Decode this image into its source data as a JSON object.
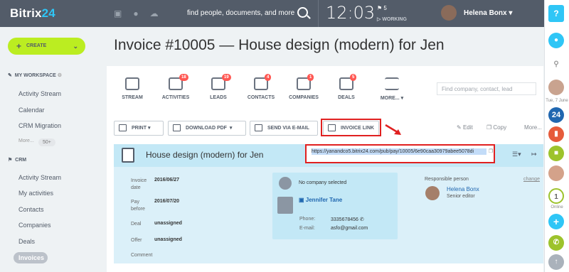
{
  "topbar": {
    "logo_main": "Bitrix",
    "logo_num": "24",
    "search_placeholder": "find people, documents, and more",
    "clock": "12:03",
    "flag_count": "5",
    "status": "WORKING",
    "user_name": "Helena Bonx"
  },
  "sidebar": {
    "create_label": "CREATE",
    "workspace": "MY WORKSPACE",
    "workspace_items": [
      "Activity Stream",
      "Calendar",
      "CRM Migration"
    ],
    "more_label": "More...",
    "more_badge": "50+",
    "crm": "CRM",
    "crm_items": [
      "Activity Stream",
      "My activities",
      "Contacts",
      "Companies",
      "Deals"
    ],
    "active_item": "Invoices"
  },
  "page": {
    "title": "Invoice #10005 — House design (modern) for Jen"
  },
  "nav_tabs": [
    {
      "label": "STREAM",
      "badge": ""
    },
    {
      "label": "ACTIVITIES",
      "badge": "18"
    },
    {
      "label": "LEADS",
      "badge": "19"
    },
    {
      "label": "CONTACTS",
      "badge": "4"
    },
    {
      "label": "COMPANIES",
      "badge": "1"
    },
    {
      "label": "DEALS",
      "badge": "5"
    },
    {
      "label": "MORE...",
      "badge": ""
    }
  ],
  "filter_placeholder": "Find company, contact, lead",
  "toolbar": {
    "print": "PRINT",
    "download": "DOWNLOAD PDF",
    "send": "SEND VIA E-MAIL",
    "link": "INVOICE LINK",
    "edit": "Edit",
    "copy": "Copy",
    "more": "More..."
  },
  "card": {
    "title": "House design (modern) for Jen",
    "url": "https://yanandco5.bitrix24.com/pub/pay/10005/6e90caa30979abee5078di",
    "fields": [
      {
        "label": "Invoice date",
        "value": "2016/06/27"
      },
      {
        "label": "Pay before",
        "value": "2016/07/20"
      },
      {
        "label": "Deal",
        "value": "unassigned"
      },
      {
        "label": "Offer",
        "value": "unassigned"
      },
      {
        "label": "Comment",
        "value": ""
      }
    ],
    "company": "No company selected",
    "contact_name": "Jennifer Tane",
    "phone_label": "Phone:",
    "phone": "3335678456",
    "email_label": "E-mail:",
    "email": "asfo@gmail.com",
    "resp_label": "Responsible person",
    "resp_change": "change",
    "resp_name": "Helena Bonx",
    "resp_title": "Senior editor"
  },
  "rail": {
    "date": "Tue, 7 June",
    "online_count": "1",
    "online_label": "Online"
  }
}
